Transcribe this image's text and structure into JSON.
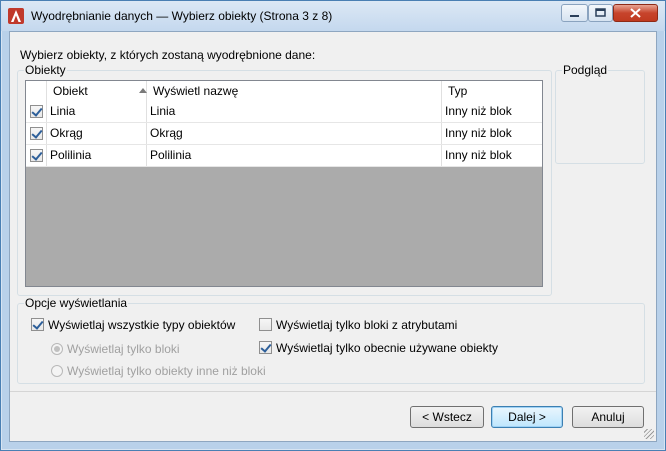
{
  "window": {
    "title": "Wyodrębnianie danych — Wybierz obiekty (Strona 3 z 8)",
    "app_icon": "autocad-logo-icon",
    "accent_color": "#c0392b"
  },
  "instruction": "Wybierz obiekty, z których zostaną wyodrębnione dane:",
  "objects_group": {
    "label": "Obiekty",
    "columns": [
      "Obiekt",
      "Wyświetl nazwę",
      "Typ"
    ],
    "sorted_column": "Obiekt",
    "rows": [
      {
        "checked": true,
        "object": "Linia",
        "display_name": "Linia",
        "type": "Inny niż blok"
      },
      {
        "checked": true,
        "object": "Okrąg",
        "display_name": "Okrąg",
        "type": "Inny niż blok"
      },
      {
        "checked": true,
        "object": "Polilinia",
        "display_name": "Polilinia",
        "type": "Inny niż blok"
      }
    ]
  },
  "preview_group": {
    "label": "Podgląd"
  },
  "display_options": {
    "label": "Opcje wyświetlania",
    "show_all_types": {
      "label": "Wyświetlaj wszystkie typy obiektów",
      "checked": true
    },
    "blocks_only": {
      "label": "Wyświetlaj tylko bloki",
      "selected": true,
      "enabled": false
    },
    "non_blocks_only": {
      "label": "Wyświetlaj tylko obiekty inne niż bloki",
      "selected": false,
      "enabled": false
    },
    "blocks_with_attributes": {
      "label": "Wyświetlaj tylko bloki z atrybutami",
      "checked": false
    },
    "in_use_only": {
      "label": "Wyświetlaj tylko obecnie używane obiekty",
      "checked": true
    }
  },
  "buttons": {
    "back": "< Wstecz",
    "next": "Dalej >",
    "cancel": "Anuluj"
  }
}
